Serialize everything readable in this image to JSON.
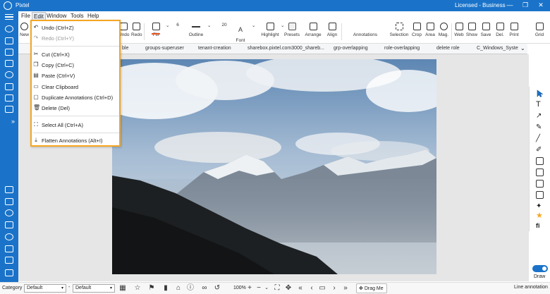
{
  "app": {
    "title": "Pixtel",
    "license": "Licensed - Business",
    "window_controls": {
      "minimize": "—",
      "restore": "❐",
      "close": "✕"
    }
  },
  "menubar": {
    "items": [
      {
        "label": "File"
      },
      {
        "label": "Edit"
      },
      {
        "label": "Window"
      },
      {
        "label": "Tools"
      },
      {
        "label": "Help"
      }
    ]
  },
  "toolbar": {
    "new_label": "New",
    "undo_label": "Undo",
    "redo_label": "Redo",
    "fill_label": "Fill",
    "outline_width": "6",
    "outline_label": "Outline",
    "font_size": "20",
    "font_label": "Font",
    "highlight_label": "Highlight",
    "presets_label": "Presets",
    "arrange_label": "Arrange",
    "align_label": "Align",
    "annotations_label": "Annotations",
    "selection_label": "Selection",
    "crop_label": "Crop",
    "area_label": "Area",
    "mag_label": "Mag.",
    "web_label": "Web",
    "show_label": "Show",
    "save_label": "Save",
    "del_label": "Del.",
    "print_label": "Print",
    "grid_label": "Grid",
    "colors": {
      "fill": "#e8541c",
      "font": "#2e9d4f",
      "highlight": "#d43ad8"
    }
  },
  "tabs": [
    {
      "label": "ble"
    },
    {
      "label": "groups-superuser"
    },
    {
      "label": "tenant-creation"
    },
    {
      "label": "sharebox.pixtel.com3000_shareb..."
    },
    {
      "label": "grp-overlapping"
    },
    {
      "label": "role-overlapping"
    },
    {
      "label": "delete role"
    },
    {
      "label": "C_Windows_Syste"
    }
  ],
  "edit_menu": {
    "undo": "Undo (Ctrl+Z)",
    "redo": "Redo (Ctrl+Y)",
    "cut": "Cut (Ctrl+X)",
    "copy": "Copy (Ctrl+C)",
    "paste": "Paste (Ctrl+V)",
    "clear": "Clear Clipboard",
    "duplicate": "Duplicate Annotations (Ctrl+D)",
    "delete": "Delete (Del)",
    "select_all": "Select All (Ctrl+A)",
    "flatten": "Flatten Annotations (Alt+I)"
  },
  "right_panel": {
    "draw_label": "Draw"
  },
  "statusbar": {
    "category_label": "Category",
    "category_value": "Default",
    "second_value": "Default",
    "zoom": "100%",
    "drag_label": "Drag Me",
    "status": "Line annotation"
  },
  "accent": "#1a73c9",
  "highlight_border": "#f5a623"
}
